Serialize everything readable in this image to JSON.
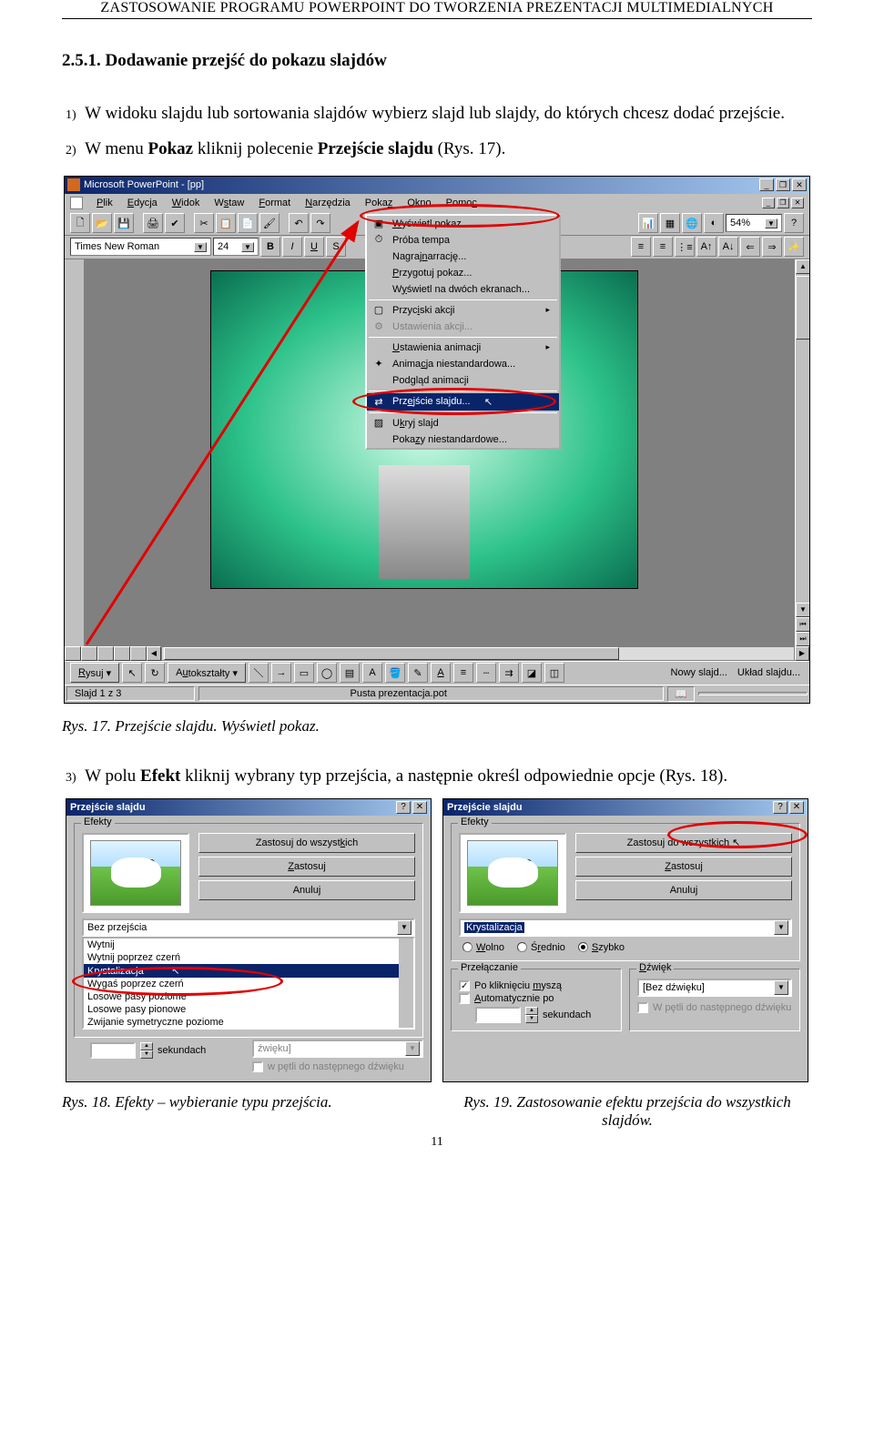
{
  "header": "ZASTOSOWANIE PROGRAMU POWERPOINT DO TWORZENIA PREZENTACJI MULTIMEDIALNYCH",
  "section_title": "2.5.1. Dodawanie przejść do pokazu slajdów",
  "step1_num": "1)",
  "step1": "W widoku slajdu lub sortowania slajdów wybierz slajd lub slajdy, do których chcesz dodać przejście.",
  "step2_num": "2)",
  "step2_a": "W menu ",
  "step2_b": "Pokaz",
  "step2_c": " kliknij polecenie ",
  "step2_d": "Przejście slajdu",
  "step2_e": " (Rys. 17).",
  "fig17_caption": "Rys. 17. Przejście slajdu. Wyświetl pokaz.",
  "step3_num": "3)",
  "step3_a": "W polu ",
  "step3_b": "Efekt",
  "step3_c": " kliknij wybrany typ przejścia, a następnie określ odpowiednie opcje (Rys. 18).",
  "fig18_caption": "Rys. 18. Efekty – wybieranie typu przejścia.",
  "fig19_caption": "Rys. 19. Zastosowanie efektu przejścia do wszystkich slajdów.",
  "page_num": "11",
  "pp": {
    "title": "Microsoft PowerPoint - [pp]",
    "menubar": [
      "Plik",
      "Edycja",
      "Widok",
      "Wstaw",
      "Format",
      "Narzędzia",
      "Pokaz",
      "Okno",
      "Pomoc"
    ],
    "font": "Times New Roman",
    "fontsize": "24",
    "zoom": "54%",
    "status_left": "Slajd 1 z 3",
    "status_mid": "Pusta prezentacja.pot",
    "draw_label": "Rysuj",
    "draw_autoshapes": "Autokształty",
    "draw_new": "Nowy slajd...",
    "draw_layout": "Układ slajdu...",
    "menu": {
      "m1": "Wyświetl pokaz",
      "m2": "Próba tempa",
      "m3": "Nagraj narrację...",
      "m4": "Przygotuj pokaz...",
      "m5": "Wyświetl na dwóch ekranach...",
      "m6": "Przyciski akcji",
      "m7": "Ustawienia akcji...",
      "m8": "Ustawienia animacji",
      "m9": "Animacja niestandardowa...",
      "m10": "Podgląd animacji",
      "m11": "Przejście slajdu...",
      "m12": "Ukryj slajd",
      "m13": "Pokazy niestandardowe..."
    }
  },
  "dlg": {
    "title": "Przejście slajdu",
    "grp_efekty": "Efekty",
    "btn_all": "Zastosuj do wszystkich",
    "btn_apply": "Zastosuj",
    "btn_cancel": "Anuluj",
    "combo_left": "Bez przejścia",
    "list_left": [
      "Wytnij",
      "Wytnij poprzez czerń",
      "Krystalizacja",
      "Wygaś poprzez czerń",
      "Losowe pasy poziome",
      "Losowe pasy pionowe",
      "Zwijanie symetryczne poziome"
    ],
    "combo_right": "Krystalizacja",
    "rb_slow": "Wolno",
    "rb_med": "Średnio",
    "rb_fast": "Szybko",
    "grp_switch": "Przełączanie",
    "chk_click": "Po kliknięciu myszą",
    "chk_auto": "Automatycznie po",
    "sek": "sekundach",
    "grp_sound": "Dźwięk",
    "combo_sound_left": "źwięku]",
    "combo_sound_right": "[Bez dźwięku]",
    "chk_loop_left": "w pętli do następnego dźwięku",
    "chk_loop_right": "W pętli do następnego dźwięku"
  }
}
